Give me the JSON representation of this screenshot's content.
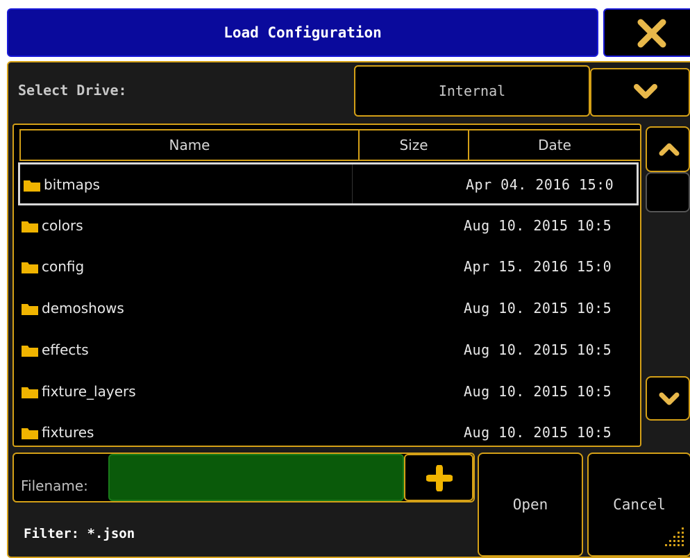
{
  "window": {
    "title": "Load Configuration"
  },
  "drive": {
    "label": "Select Drive:",
    "value": "Internal"
  },
  "columns": {
    "name": "Name",
    "size": "Size",
    "date": "Date"
  },
  "files": [
    {
      "name": "bitmaps",
      "date": "Apr 04. 2016 15:0",
      "selected": true
    },
    {
      "name": "colors",
      "date": "Aug 10. 2015 10:5"
    },
    {
      "name": "config",
      "date": "Apr 15. 2016 15:0"
    },
    {
      "name": "demoshows",
      "date": "Aug 10. 2015 10:5"
    },
    {
      "name": "effects",
      "date": "Aug 10. 2015 10:5"
    },
    {
      "name": "fixture_layers",
      "date": "Aug 10. 2015 10:5"
    },
    {
      "name": "fixtures",
      "date": "Aug 10. 2015 10:5"
    }
  ],
  "filename": {
    "label": "Filename:",
    "value": ""
  },
  "filter": {
    "text": "Filter: *.json"
  },
  "buttons": {
    "open": "Open",
    "cancel": "Cancel"
  },
  "colors": {
    "accent": "#d4a017",
    "title_bar": "#0a0a9c",
    "input_bg": "#0a5a0a"
  },
  "icons": {
    "close": "close-icon",
    "dropdown": "chevron-down-icon",
    "scroll_up": "chevron-up-icon",
    "scroll_down": "chevron-down-icon",
    "add": "plus-icon",
    "folder": "folder-icon"
  }
}
